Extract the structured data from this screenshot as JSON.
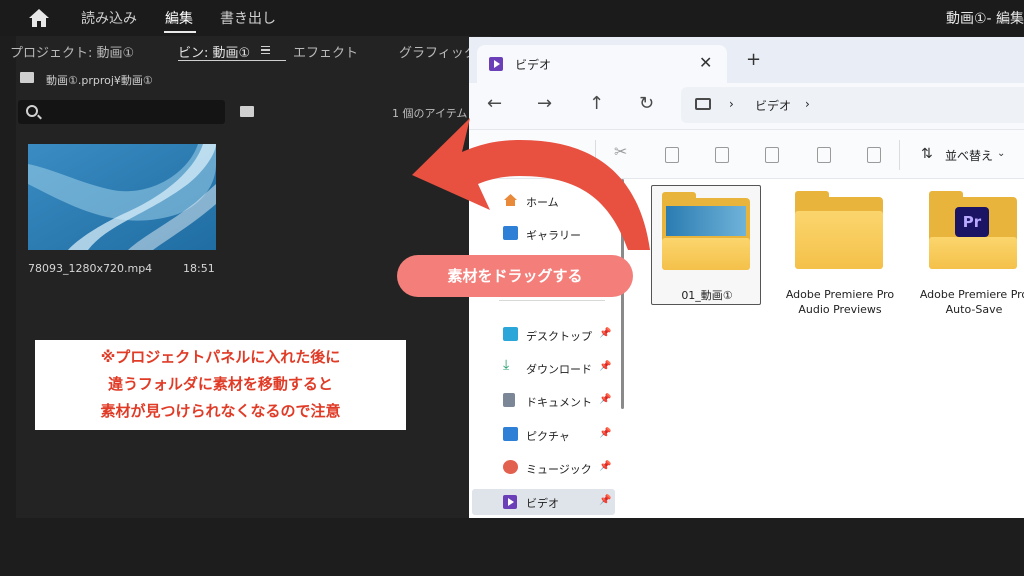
{
  "topbar": {
    "nav": [
      "読み込み",
      "編集",
      "書き出し"
    ],
    "active": "編集",
    "project_title": "動画①- 編集"
  },
  "panel": {
    "tabs": [
      "プロジェクト: 動画①",
      "ビン: 動画①",
      "エフェクト",
      "グラフィック"
    ],
    "path": "動画①.prproj¥動画①",
    "search_placeholder": "",
    "item_count": "1 個のアイテム",
    "clip": {
      "name": "78093_1280x720.mp4",
      "duration": "18:51"
    }
  },
  "note": {
    "lines": [
      "※プロジェクトパネルに入れた後に",
      "違うフォルダに素材を移動すると",
      "素材が見つけられなくなるので注意"
    ]
  },
  "explorer": {
    "tab_title": "ビデオ",
    "breadcrumb": [
      "ビデオ"
    ],
    "sort_label": "並べ替え",
    "sidebar": [
      {
        "label": "ホーム",
        "icon": "home-icon",
        "color": "#e98a3a",
        "pinned": false
      },
      {
        "label": "ギャラリー",
        "icon": "gallery-icon",
        "color": "#2e7fd6",
        "pinned": false
      },
      {
        "label": "デスクトップ",
        "icon": "desktop-icon",
        "color": "#2aa7d8",
        "pinned": true
      },
      {
        "label": "ダウンロード",
        "icon": "download-icon",
        "color": "#1f9e6b",
        "pinned": true
      },
      {
        "label": "ドキュメント",
        "icon": "document-icon",
        "color": "#7b8796",
        "pinned": true
      },
      {
        "label": "ピクチャ",
        "icon": "pictures-icon",
        "color": "#2e7fd6",
        "pinned": true
      },
      {
        "label": "ミュージック",
        "icon": "music-icon",
        "color": "#e2604e",
        "pinned": true
      },
      {
        "label": "ビデオ",
        "icon": "video-icon",
        "color": "#6b3fb8",
        "pinned": true
      }
    ],
    "items": [
      {
        "label": "01_動画①",
        "type": "clip-folder"
      },
      {
        "label": "Adobe Premiere Pro Audio Previews",
        "type": "folder"
      },
      {
        "label": "Adobe Premiere Pro Auto-Save",
        "type": "premiere-folder"
      }
    ]
  },
  "overlay": {
    "drag_label": "素材をドラッグする",
    "arrow_color": "#e85040"
  }
}
